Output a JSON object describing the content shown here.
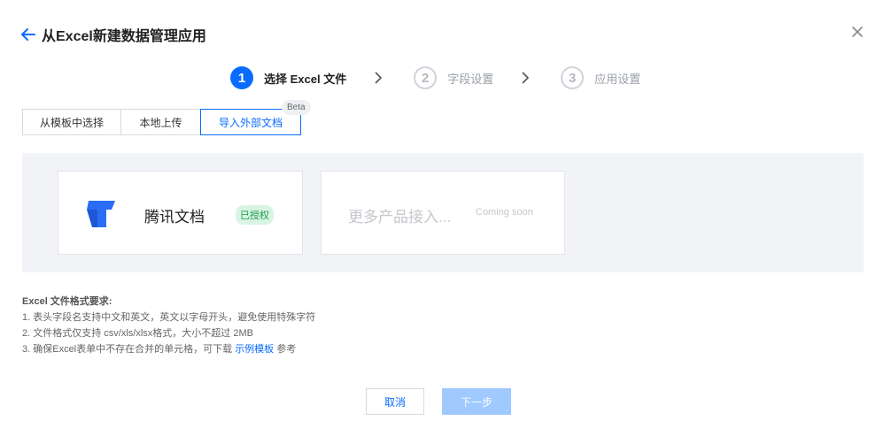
{
  "header": {
    "title": "从Excel新建数据管理应用"
  },
  "steps": [
    {
      "num": "1",
      "label": "选择 Excel 文件"
    },
    {
      "num": "2",
      "label": "字段设置"
    },
    {
      "num": "3",
      "label": "应用设置"
    }
  ],
  "tabs": [
    {
      "label": "从模板中选择"
    },
    {
      "label": "本地上传"
    },
    {
      "label": "导入外部文档"
    }
  ],
  "beta_badge": "Beta",
  "cards": {
    "tencent_docs": {
      "name": "腾讯文档",
      "badge": "已授权"
    },
    "more": {
      "text": "更多产品接入...",
      "coming": "Coming soon"
    }
  },
  "requirements": {
    "title": "Excel 文件格式要求:",
    "line1": "1. 表头字段名支持中文和英文，英文以字母开头，避免使用特殊字符",
    "line2": "2. 文件格式仅支持 csv/xls/xlsx格式，大小不超过 2MB",
    "line3_pre": "3. 确保Excel表单中不存在合并的单元格，可下载 ",
    "line3_link": "示例模板",
    "line3_post": " 参考"
  },
  "buttons": {
    "cancel": "取消",
    "next": "下一步"
  },
  "colors": {
    "accent": "#0a6cff",
    "success": "#1a9a4c",
    "panel_bg": "#f2f3f7"
  }
}
